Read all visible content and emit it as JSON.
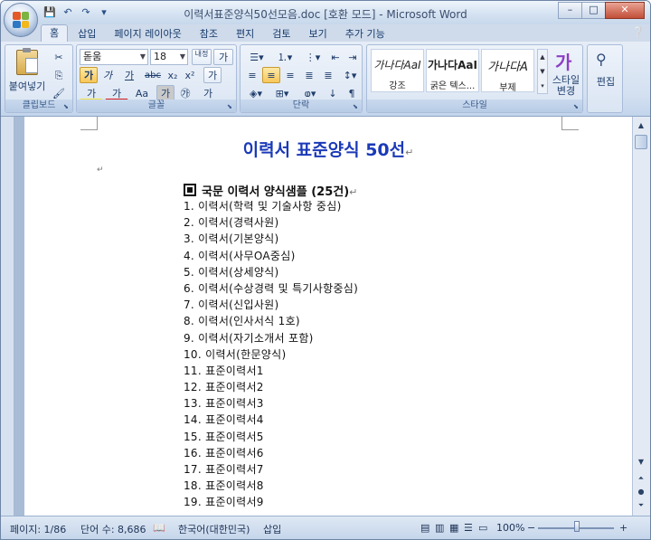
{
  "window": {
    "title": "이력서표준양식50선모음.doc [호환 모드] - Microsoft Word",
    "controls": {
      "minimize": "–",
      "maximize": "□",
      "close": "✕"
    }
  },
  "quick_access": {
    "save": "💾",
    "undo": "↶",
    "redo": "↷",
    "more": "▾"
  },
  "tabs": [
    "홈",
    "삽입",
    "페이지 레이아웃",
    "참조",
    "편지",
    "검토",
    "보기",
    "추가 기능"
  ],
  "ribbon": {
    "clipboard": {
      "label": "클립보드",
      "paste_label": "붙여넣기"
    },
    "font": {
      "label": "글꼴",
      "font_name": "돋움",
      "font_size": "18",
      "buttons": [
        "가",
        "가",
        "가",
        "abc",
        "x₂",
        "x²",
        "Aa",
        "가",
        "가",
        "가"
      ],
      "bold": "가",
      "italic": "가",
      "underline": "가",
      "strike": "abc",
      "subscript": "x₂",
      "superscript": "x²",
      "clear": "가",
      "char_border": "가",
      "change_case": "Aa",
      "highlight": "가",
      "font_color": "가",
      "char_shading": "가",
      "enclosed": "㉮",
      "phonetic": "가",
      "grow": "내정",
      "shrink": "가"
    },
    "paragraph": {
      "label": "단락"
    },
    "styles": {
      "label": "스타일",
      "items": [
        {
          "sample": "가나다AaI",
          "name": "강조"
        },
        {
          "sample": "가나다AaI",
          "name": "굵은 텍스..."
        },
        {
          "sample": "가나다A",
          "name": "부제"
        }
      ],
      "change_styles": "스타일\n변경"
    },
    "editing": {
      "label": "편집"
    }
  },
  "document": {
    "title": "이력서 표준양식 50선",
    "section_heading": "국문 이력서 양식샘플 (25건)",
    "list": [
      "1. 이력서(학력 및 기술사항 중심)",
      "2. 이력서(경력사원)",
      "3. 이력서(기본양식)",
      "4. 이력서(사무OA중심)",
      "5. 이력서(상세양식)",
      "6. 이력서(수상경력 및 특기사항중심)",
      "7. 이력서(신입사원)",
      "8. 이력서(인사서식 1호)",
      "9. 이력서(자기소개서 포함)",
      "10. 이력서(한문양식)",
      "11. 표준이력서1",
      "12. 표준이력서2",
      "13. 표준이력서3",
      "14. 표준이력서4",
      "15. 표준이력서5",
      "16. 표준이력서6",
      "17. 표준이력서7",
      "18. 표준이력서8",
      "19. 표준이력서9"
    ],
    "paragraph_mark": "↵"
  },
  "status_bar": {
    "page": "페이지: 1/86",
    "word_count": "단어 수: 8,686",
    "language": "한국어(대한민국)",
    "mode": "삽입",
    "zoom": "100%",
    "zoom_minus": "−",
    "zoom_plus": "+"
  },
  "colors": {
    "accent": "#1b3ab8",
    "ribbon": "#d4e1f1",
    "titlebar": "#dbe6f3"
  }
}
